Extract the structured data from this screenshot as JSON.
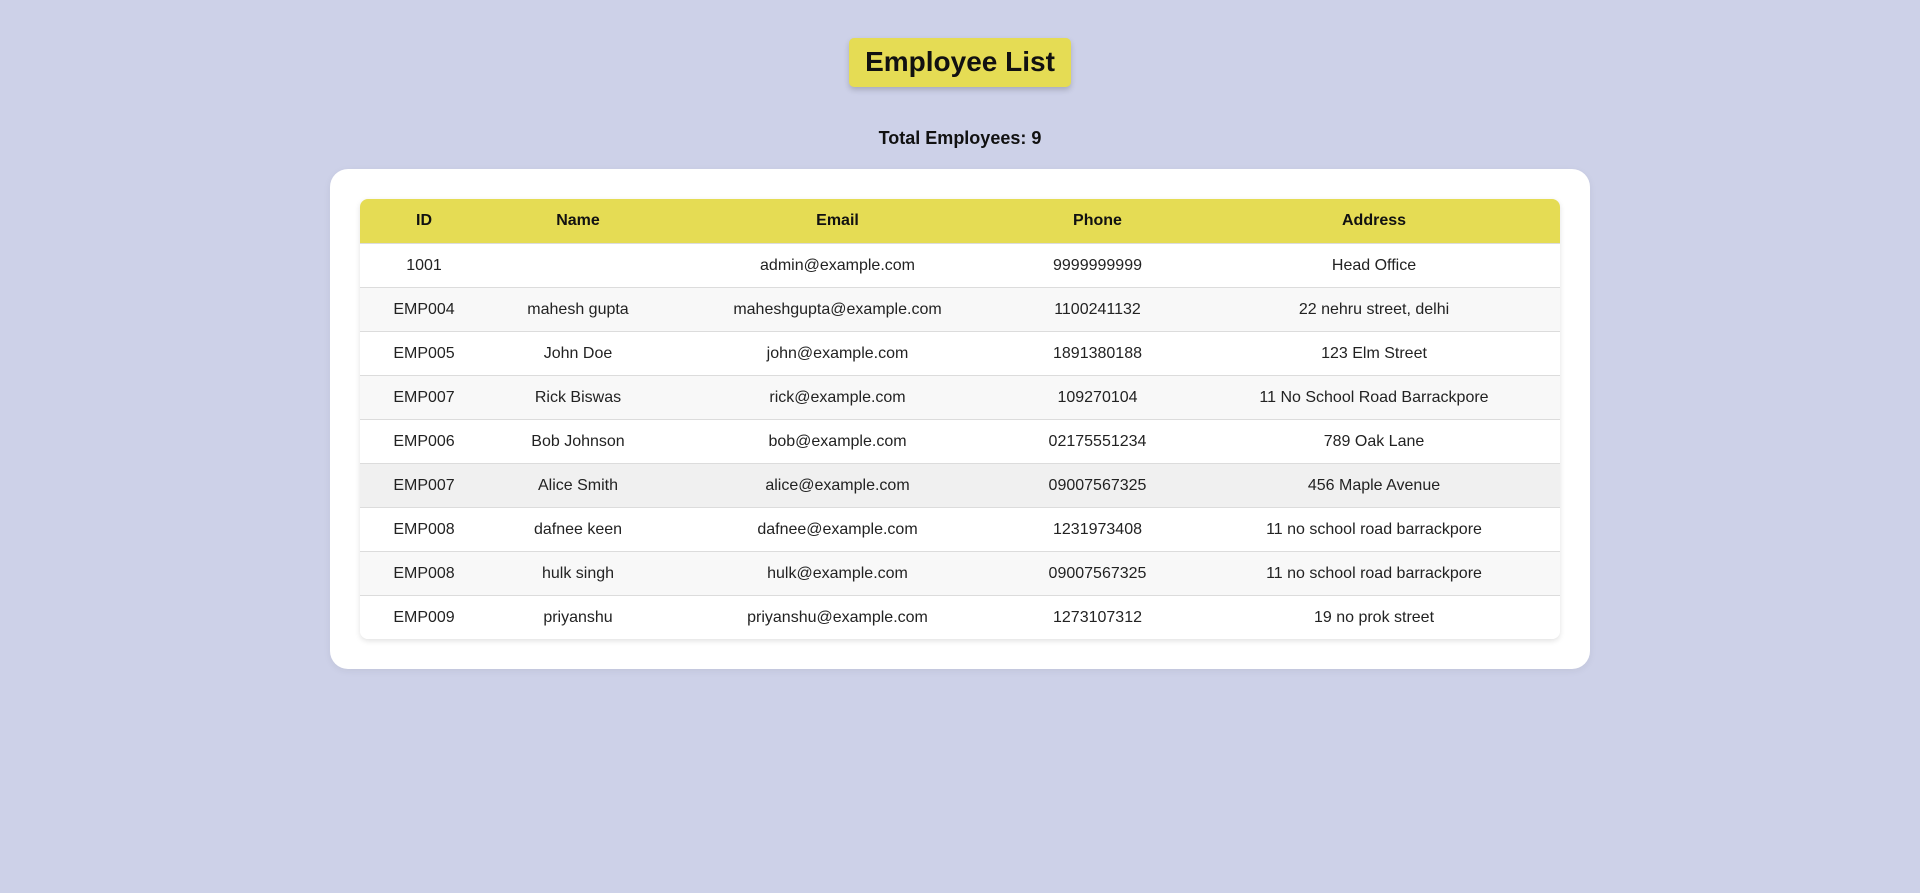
{
  "page": {
    "title": "Employee List",
    "total_label": "Total Employees: 9"
  },
  "colors": {
    "background": "#cdd1e8",
    "accent": "#e5dc54",
    "card": "#ffffff"
  },
  "table": {
    "headers": [
      "ID",
      "Name",
      "Email",
      "Phone",
      "Address"
    ],
    "rows": [
      {
        "id": "1001",
        "name": "",
        "email": "admin@example.com",
        "phone": "9999999999",
        "address": "Head Office"
      },
      {
        "id": "EMP004",
        "name": "mahesh gupta",
        "email": "maheshgupta@example.com",
        "phone": "1100241132",
        "address": "22 nehru street, delhi"
      },
      {
        "id": "EMP005",
        "name": "John Doe",
        "email": "john@example.com",
        "phone": "1891380188",
        "address": "123 Elm Street"
      },
      {
        "id": "EMP007",
        "name": "Rick Biswas",
        "email": "rick@example.com",
        "phone": "109270104",
        "address": "11 No School Road Barrackpore"
      },
      {
        "id": "EMP006",
        "name": "Bob Johnson",
        "email": "bob@example.com",
        "phone": "02175551234",
        "address": "789 Oak Lane"
      },
      {
        "id": "EMP007",
        "name": "Alice Smith",
        "email": "alice@example.com",
        "phone": "09007567325",
        "address": "456 Maple Avenue"
      },
      {
        "id": "EMP008",
        "name": "dafnee keen",
        "email": "dafnee@example.com",
        "phone": "1231973408",
        "address": "11 no school road barrackpore"
      },
      {
        "id": "EMP008",
        "name": "hulk singh",
        "email": "hulk@example.com",
        "phone": "09007567325",
        "address": "11 no school road barrackpore"
      },
      {
        "id": "EMP009",
        "name": "priyanshu",
        "email": "priyanshu@example.com",
        "phone": "1273107312",
        "address": "19 no prok street"
      }
    ]
  }
}
